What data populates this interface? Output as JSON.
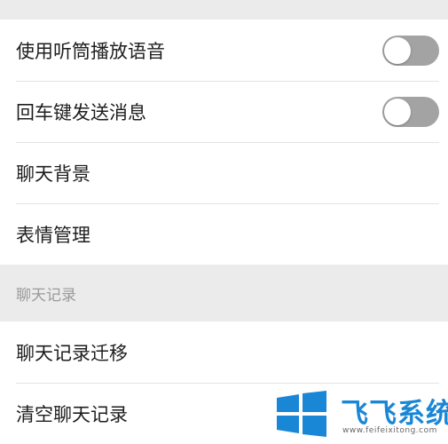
{
  "settings_group_1": {
    "items": [
      {
        "label": "使用听筒播放语音",
        "toggle_on": false
      },
      {
        "label": "回车键发送消息",
        "toggle_on": false
      },
      {
        "label": "聊天背景"
      },
      {
        "label": "表情管理"
      }
    ]
  },
  "chat_history_section": {
    "header": "聊天记录",
    "items": [
      {
        "label": "聊天记录迁移"
      },
      {
        "label": "清空聊天记录"
      }
    ]
  },
  "watermark": {
    "brand": "飞飞系统",
    "url": "www.feifeixitong.com"
  },
  "colors": {
    "toggle_off": "#a3a3a3",
    "brand_blue": "#1a86d6",
    "background": "#ebebeb"
  }
}
